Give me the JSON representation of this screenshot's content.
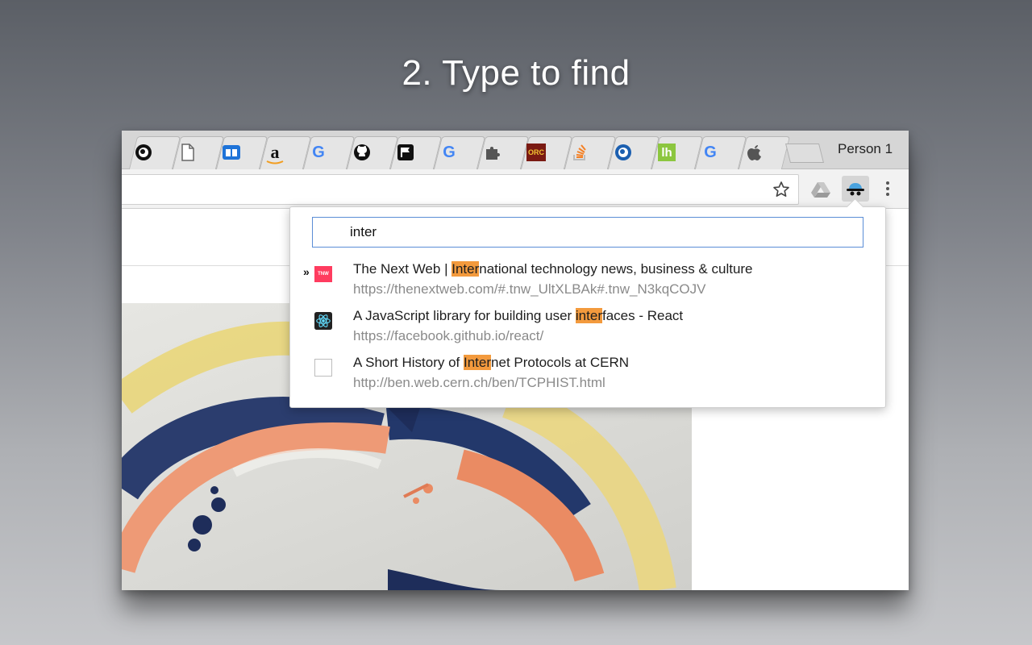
{
  "headline": "2. Type to find",
  "colors": {
    "highlight": "#f39a3d",
    "search_border": "#5b8ed6",
    "url_text": "#8a8a8a"
  },
  "tabs": [
    {
      "icon": "pbs-icon"
    },
    {
      "icon": "blank-page-icon"
    },
    {
      "icon": "blue-book-icon"
    },
    {
      "icon": "amazon-icon"
    },
    {
      "icon": "google-icon"
    },
    {
      "icon": "github-icon"
    },
    {
      "icon": "flag-icon"
    },
    {
      "icon": "google-icon"
    },
    {
      "icon": "puzzle-icon"
    },
    {
      "icon": "orc-icon"
    },
    {
      "icon": "stackoverflow-icon"
    },
    {
      "icon": "pbs-icon"
    },
    {
      "icon": "lh-icon"
    },
    {
      "icon": "google-icon"
    },
    {
      "icon": "apple-icon"
    }
  ],
  "tab_text": {
    "amazon": "a",
    "google": "G",
    "orc": "ORC",
    "lh": "lh"
  },
  "profile": {
    "name": "Person 1"
  },
  "toolbar": {
    "star_icon": "star-icon",
    "drive_icon": "drive-icon",
    "extension_icon": "spy-hat-icon",
    "menu_icon": "kebab-menu-icon"
  },
  "popup": {
    "search_value": "inter",
    "results": [
      {
        "marker": "»",
        "favicon": "tnw-icon",
        "favicon_text": "TNW",
        "title_before": "The Next Web | ",
        "title_match": "Inter",
        "title_after": "national technology news, business & culture",
        "url": "https://thenextweb.com/#.tnw_UltXLBAk#.tnw_N3kqCOJV"
      },
      {
        "marker": "",
        "favicon": "react-icon",
        "title_before": "A JavaScript library for building user ",
        "title_match": "inter",
        "title_after": "faces - React",
        "url": "https://facebook.github.io/react/"
      },
      {
        "marker": "",
        "favicon": "blank-page-icon",
        "title_before": "A Short History of ",
        "title_match": "Inter",
        "title_after": "net Protocols at CERN",
        "url": "http://ben.web.cern.ch/ben/TCPHIST.html"
      }
    ]
  }
}
